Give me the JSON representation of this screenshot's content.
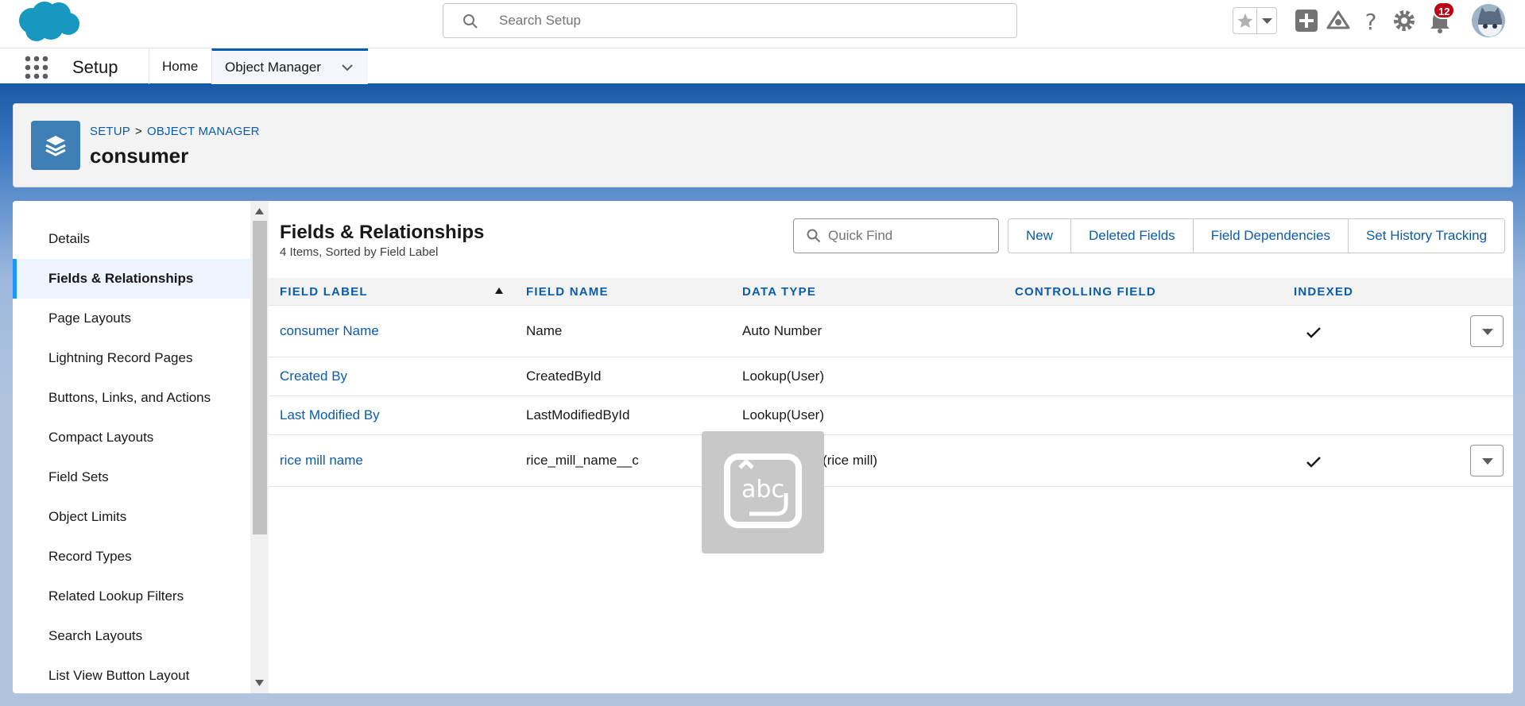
{
  "header": {
    "search_placeholder": "Search Setup",
    "notification_count": "12"
  },
  "app_nav": {
    "app_name": "Setup",
    "tabs": [
      {
        "label": "Home"
      },
      {
        "label": "Object Manager"
      }
    ]
  },
  "page_header": {
    "breadcrumb": [
      "SETUP",
      ">",
      "OBJECT MANAGER"
    ],
    "title": "consumer"
  },
  "sidebar": {
    "items": [
      {
        "label": "Details"
      },
      {
        "label": "Fields & Relationships"
      },
      {
        "label": "Page Layouts"
      },
      {
        "label": "Lightning Record Pages"
      },
      {
        "label": "Buttons, Links, and Actions"
      },
      {
        "label": "Compact Layouts"
      },
      {
        "label": "Field Sets"
      },
      {
        "label": "Object Limits"
      },
      {
        "label": "Record Types"
      },
      {
        "label": "Related Lookup Filters"
      },
      {
        "label": "Search Layouts"
      },
      {
        "label": "List View Button Layout"
      }
    ]
  },
  "content": {
    "title": "Fields & Relationships",
    "subtitle": "4 Items, Sorted by Field Label",
    "quick_find_placeholder": "Quick Find",
    "buttons": [
      "New",
      "Deleted Fields",
      "Field Dependencies",
      "Set History Tracking"
    ],
    "columns": [
      "FIELD LABEL",
      "FIELD NAME",
      "DATA TYPE",
      "CONTROLLING FIELD",
      "INDEXED"
    ],
    "rows": [
      {
        "label": "consumer Name",
        "name": "Name",
        "type": "Auto Number",
        "controlling": "",
        "indexed": true,
        "menu": true
      },
      {
        "label": "Created By",
        "name": "CreatedById",
        "type": "Lookup(User)",
        "controlling": "",
        "indexed": false,
        "menu": false
      },
      {
        "label": "Last Modified By",
        "name": "LastModifiedById",
        "type": "Lookup(User)",
        "controlling": "",
        "indexed": false,
        "menu": false
      },
      {
        "label": "rice mill name",
        "name": "rice_mill_name__c",
        "type": "Master-Detail(rice mill)",
        "controlling": "",
        "indexed": true,
        "menu": true
      }
    ]
  },
  "overlay": {
    "label": "abc"
  },
  "colors": {
    "brand": "#0b5cab",
    "active_indicator": "#1b96ff",
    "notification_badge": "#ba0517"
  }
}
